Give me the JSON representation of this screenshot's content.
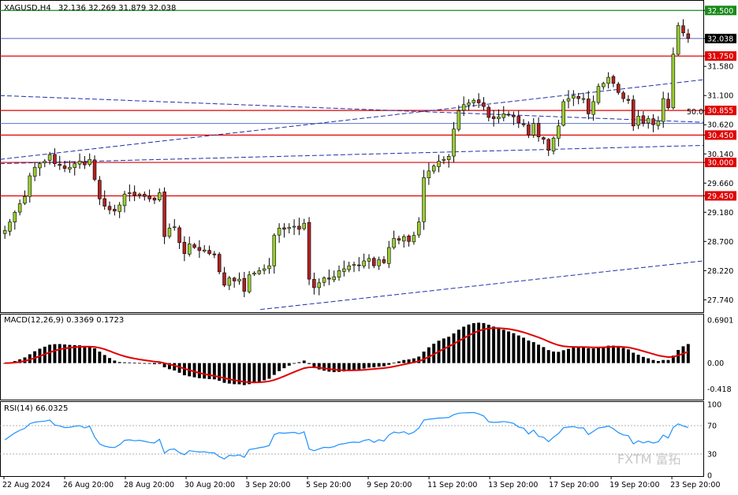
{
  "header": {
    "symbol": "XAGUSD,H4",
    "ohlc": "32.136 32.269 31.879 32.038"
  },
  "watermark": "FXTM 富拓",
  "colors": {
    "bull": "#9acd32",
    "bear": "#b22222",
    "hline": "#e00000",
    "trend": "#1f2fa8",
    "current": "#1f2fa8",
    "macd_hist": "#000000",
    "macd_signal": "#e00000",
    "rsi": "#1e90ff"
  },
  "chart_data": [
    {
      "type": "candlestick",
      "name": "price",
      "ylim": [
        27.55,
        32.62
      ],
      "y_ticks": [
        "32.500",
        "32.038",
        "31.750",
        "31.580",
        "31.100",
        "30.855",
        "30.620",
        "30.450",
        "30.140",
        "30.000",
        "29.660",
        "29.450",
        "29.180",
        "28.700",
        "28.220",
        "27.740"
      ],
      "x_tick_labels": [
        "22 Aug 2024",
        "26 Aug 20:00",
        "28 Aug 20:00",
        "30 Aug 20:00",
        "3 Sep 20:00",
        "5 Sep 20:00",
        "9 Sep 20:00",
        "11 Sep 20:00",
        "13 Sep 20:00",
        "17 Sep 20:00",
        "19 Sep 20:00",
        "23 Sep 20:00"
      ],
      "horizontal_levels": [
        {
          "value": 32.5,
          "label": "32.500",
          "color": "green"
        },
        {
          "value": 31.75,
          "label": "31.750",
          "color": "red"
        },
        {
          "value": 30.855,
          "label": "30.855",
          "color": "red"
        },
        {
          "value": 30.45,
          "label": "30.450",
          "color": "red"
        },
        {
          "value": 30.0,
          "label": "30.000",
          "color": "red"
        },
        {
          "value": 29.45,
          "label": "29.450",
          "color": "red"
        }
      ],
      "current_price": {
        "value": 32.038,
        "label": "32.038"
      },
      "fib_label": "50.0",
      "closes": [
        28.88,
        29.02,
        29.18,
        29.32,
        29.44,
        29.78,
        29.92,
        29.98,
        30.02,
        30.13,
        29.98,
        29.95,
        29.9,
        29.92,
        29.98,
        30.02,
        29.96,
        30.05,
        29.72,
        29.4,
        29.28,
        29.22,
        29.2,
        29.3,
        29.48,
        29.5,
        29.46,
        29.48,
        29.44,
        29.4,
        29.38,
        29.5,
        28.78,
        28.92,
        28.94,
        28.68,
        28.5,
        28.66,
        28.6,
        28.55,
        28.56,
        28.5,
        28.48,
        28.2,
        27.98,
        28.1,
        28.05,
        28.08,
        27.88,
        28.15,
        28.18,
        28.22,
        28.25,
        28.3,
        28.8,
        28.92,
        28.9,
        28.93,
        28.95,
        28.9,
        29.0,
        28.08,
        27.94,
        28.02,
        28.1,
        28.08,
        28.12,
        28.22,
        28.25,
        28.3,
        28.32,
        28.3,
        28.38,
        28.42,
        28.3,
        28.4,
        28.35,
        28.6,
        28.75,
        28.72,
        28.78,
        28.7,
        28.8,
        29.02,
        29.75,
        29.86,
        29.94,
        30.02,
        30.05,
        30.1,
        30.55,
        30.85,
        30.95,
        30.98,
        31.02,
        30.98,
        30.92,
        30.74,
        30.72,
        30.75,
        30.8,
        30.78,
        30.75,
        30.65,
        30.62,
        30.45,
        30.64,
        30.42,
        30.38,
        30.2,
        30.4,
        30.6,
        31.0,
        31.05,
        31.1,
        31.05,
        31.05,
        30.8,
        31.0,
        31.25,
        31.3,
        31.4,
        31.3,
        31.15,
        31.05,
        31.02,
        30.6,
        30.76,
        30.64,
        30.72,
        30.62,
        30.68,
        31.05,
        30.9,
        31.78,
        32.25,
        32.13,
        32.04
      ],
      "macd": {
        "label": "MACD(12,26,9) 0.3369 0.1723",
        "ylim": [
          -0.56,
          0.74
        ],
        "y_ticks": [
          "0.6901",
          "0.00",
          "-0.418"
        ]
      },
      "rsi": {
        "label": "RSI(14) 66.0325",
        "ylim": [
          0,
          100
        ],
        "y_ticks": [
          "100",
          "70",
          "30",
          "0"
        ],
        "levels": [
          70,
          30
        ]
      }
    }
  ]
}
